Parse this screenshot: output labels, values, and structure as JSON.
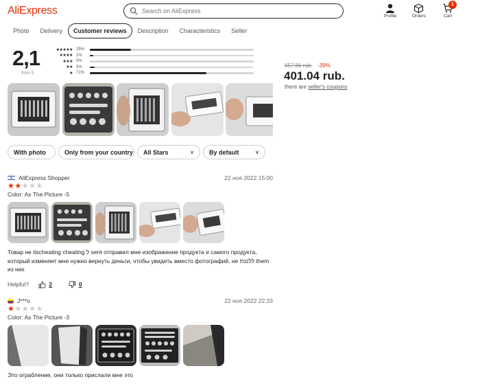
{
  "header": {
    "logo": "AliExpress",
    "search_placeholder": "Search on AliExpress",
    "profile_label": "Profile",
    "orders_label": "Orders",
    "cart_label": "Cart",
    "cart_count": "1",
    "accent": "#e62e04"
  },
  "tabs": [
    "Photo",
    "Delivery",
    "Customer reviews",
    "Description",
    "Characteristics",
    "Seller"
  ],
  "active_tab": "Customer reviews",
  "rating": {
    "value": "2,1",
    "from_label": "from 5",
    "distribution": [
      {
        "stars": "★★★★★",
        "pct": "25%",
        "fraction": 0.25
      },
      {
        "stars": "★★★★",
        "pct": "2%",
        "fraction": 0.02
      },
      {
        "stars": "★★★",
        "pct": "0%",
        "fraction": 0.0
      },
      {
        "stars": "★★",
        "pct": "3%",
        "fraction": 0.03
      },
      {
        "stars": "★",
        "pct": "71%",
        "fraction": 0.71
      }
    ]
  },
  "price": {
    "old": "657.86 rub.",
    "discount": "-39%",
    "current": "401.04 rub.",
    "coupon_prefix": "there are",
    "coupon_link": "seller's coupons"
  },
  "filters": {
    "with_photo": "With photo",
    "only_country": "Only from your country",
    "stars": "All Stars",
    "sort": "By default"
  },
  "reviews": [
    {
      "author": "AliExpress Shopper",
      "date": "22 ноя 2022 15:00",
      "rating": 2,
      "color": "Color: As The Picture -5",
      "text": "Товар не itscheating cheating ל sent отправил мне изображение продукта и самого продукта, который изменяет мне нужно вернуть деньги, чтобы увидеть вместо фотографий, не ללננת them из них",
      "helpful_label": "Helpful?",
      "likes": "2",
      "dislikes": "0"
    },
    {
      "author": "J***o",
      "date": "22 ноя 2022 22:33",
      "rating": 1,
      "color": "Color: As The Picture -3",
      "text": "Это ограбление, они только прислали мне это"
    }
  ]
}
